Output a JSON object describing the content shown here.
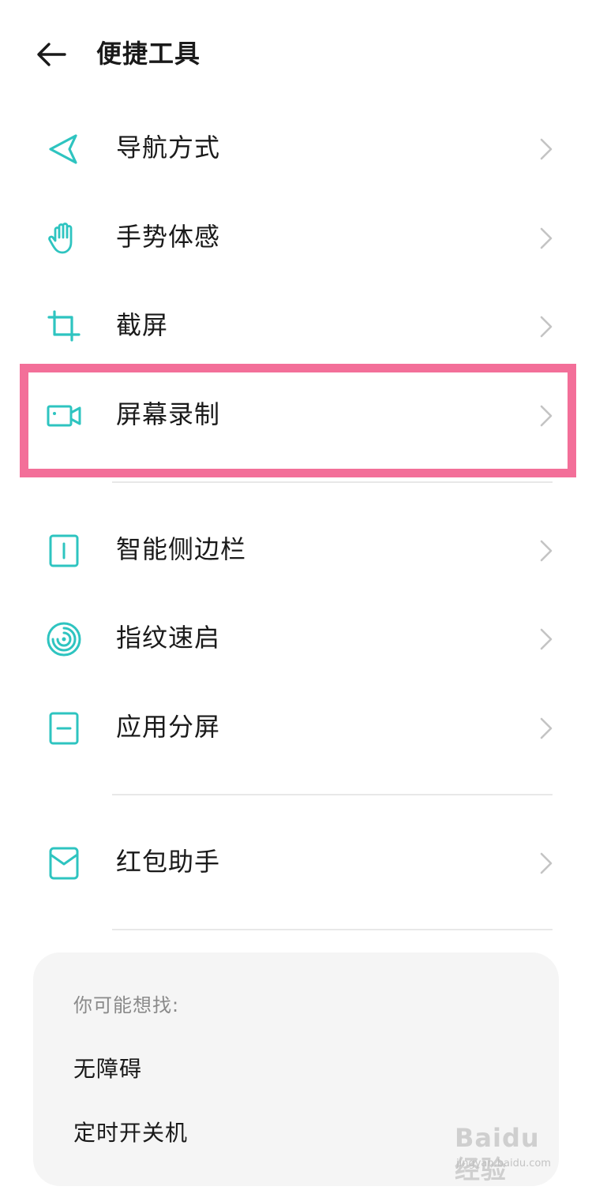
{
  "header": {
    "title": "便捷工具",
    "back_icon": "arrow-left-icon"
  },
  "accent_color": "#2ec4c0",
  "highlight_color": "#f36f99",
  "menu": {
    "items": [
      {
        "label": "导航方式",
        "icon": "navigation-icon"
      },
      {
        "label": "手势体感",
        "icon": "hand-gesture-icon"
      },
      {
        "label": "截屏",
        "icon": "crop-icon"
      },
      {
        "label": "屏幕录制",
        "icon": "video-camera-icon",
        "highlighted": true
      },
      {
        "label": "智能侧边栏",
        "icon": "sidebar-icon"
      },
      {
        "label": "指纹速启",
        "icon": "fingerprint-icon"
      },
      {
        "label": "应用分屏",
        "icon": "split-screen-icon"
      },
      {
        "label": "红包助手",
        "icon": "red-envelope-icon"
      }
    ]
  },
  "suggestions": {
    "title": "你可能想找:",
    "items": [
      "无障碍",
      "定时开关机"
    ]
  },
  "watermark": {
    "brand": "Baidu经验",
    "url": "jingyan.baidu.com"
  }
}
